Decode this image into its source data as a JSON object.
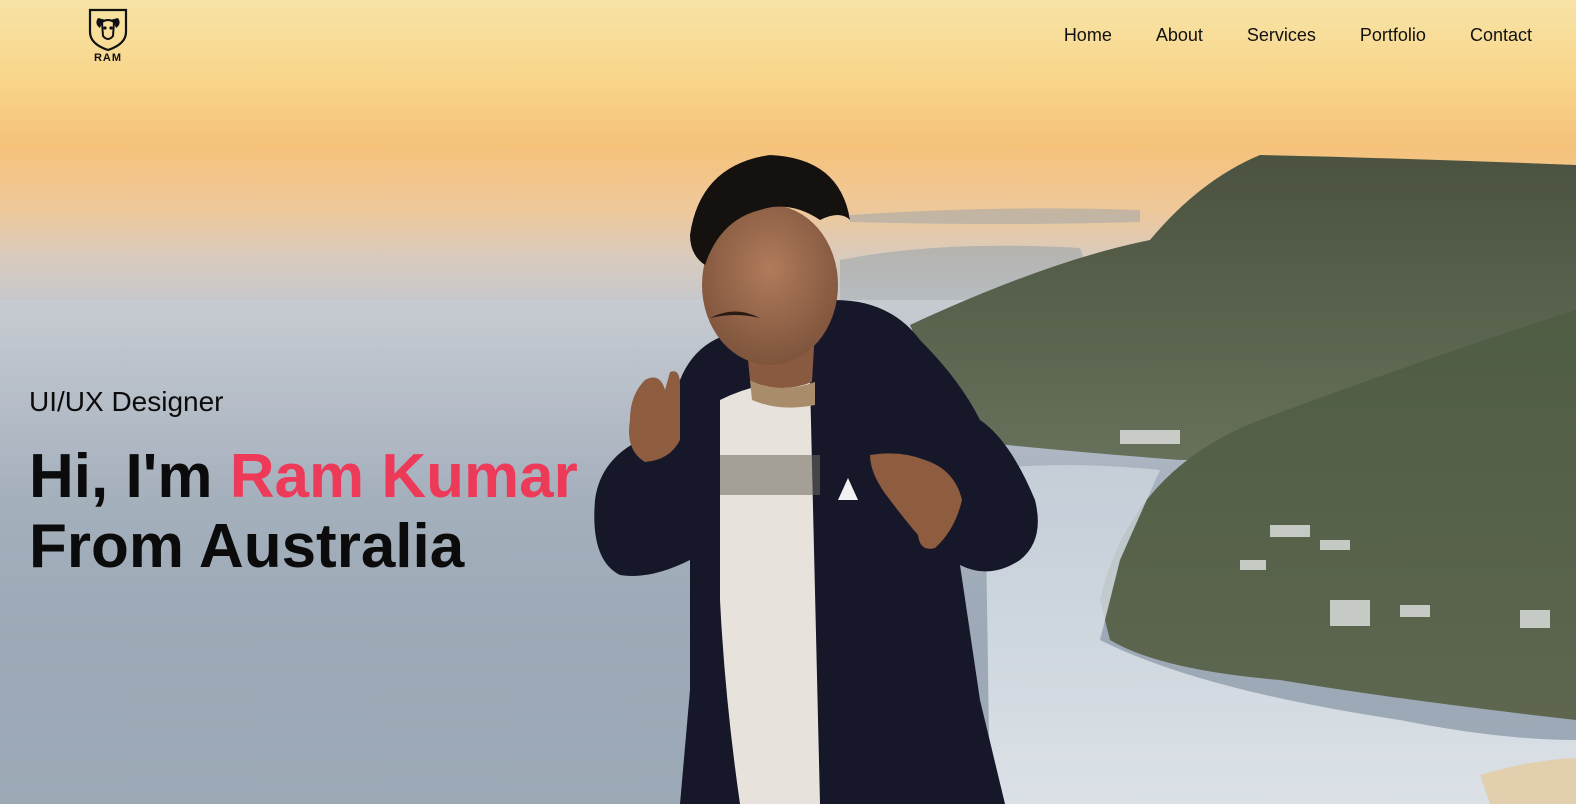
{
  "brand": {
    "logo_text": "RAM",
    "logo_icon": "ram-head-icon"
  },
  "nav": {
    "items": [
      {
        "label": "Home"
      },
      {
        "label": "About"
      },
      {
        "label": "Services"
      },
      {
        "label": "Portfolio"
      },
      {
        "label": "Contact"
      }
    ]
  },
  "hero": {
    "role": "UI/UX Designer",
    "greeting": "Hi, I'm ",
    "name": "Ram Kumar",
    "location_line": "From Australia",
    "accent_color": "#ee3a59"
  }
}
